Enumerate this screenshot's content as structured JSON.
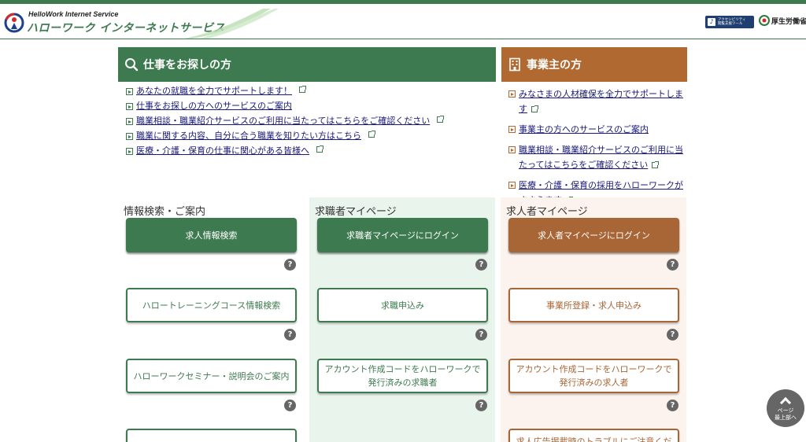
{
  "header": {
    "logo_en": "HelloWork Internet Service",
    "logo_ja": "ハローワーク インターネットサービス",
    "accessibility_label": "アクセシビリティ\n閲覧支援ツール",
    "ministry_label": "厚生労働省"
  },
  "job_seeker_section": {
    "title": "仕事をお探しの方",
    "links": [
      "あなたの就職を全力でサポートします！",
      "仕事をお探しの方へのサービスのご案内",
      "職業相談・職業紹介サービスのご利用に当たってはこちらをご確認ください",
      "職業に関する内容、自分に合う職業を知りたい方はこちら",
      "医療・介護・保育の仕事に関心がある皆様へ"
    ]
  },
  "employer_section": {
    "title": "事業主の方",
    "links": [
      "みなさまの人材確保を全力でサポートします",
      "事業主の方へのサービスのご案内",
      "職業相談・職業紹介サービスのご利用に当たってはこちらをご確認ください",
      "医療・介護・保育の採用をハローワークがささえます"
    ]
  },
  "columns": {
    "info": {
      "title": "情報検索・ご案内",
      "buttons": [
        "求人情報検索",
        "ハロートレーニングコース情報検索",
        "ハローワークセミナー・説明会のご案内",
        ""
      ]
    },
    "seeker": {
      "title": "求職者マイページ",
      "buttons": [
        "求職者マイページにログイン",
        "求職申込み",
        "アカウント作成コードをハローワークで\n発行済みの求職者"
      ]
    },
    "employer": {
      "title": "求人者マイページ",
      "buttons": [
        "求人者マイページにログイン",
        "事業所登録・求人申込み",
        "アカウント作成コードをハローワークで\n発行済みの求人者",
        "求人広告掲載時のトラブルにご注意くだ"
      ]
    }
  },
  "help_glyph": "?",
  "page_top": {
    "line1": "ページ",
    "line2": "最上部へ"
  },
  "colors": {
    "green": "#3d7a4f",
    "brown": "#b06a31",
    "seeker_bg": "#e9f5ec",
    "employer_bg": "#fdf3ee"
  }
}
